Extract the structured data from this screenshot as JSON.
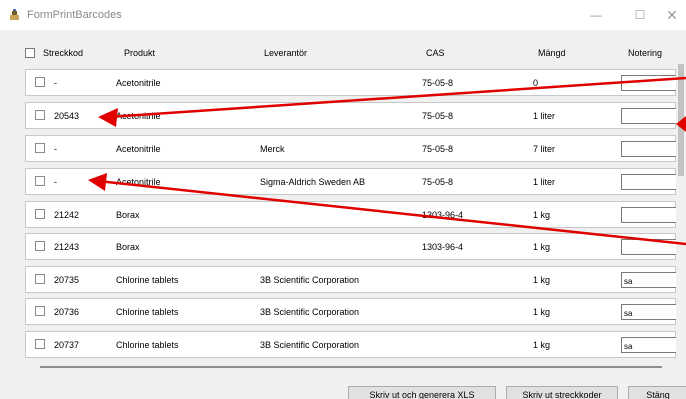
{
  "window": {
    "title": "FormPrintBarcodes",
    "minimize": "—",
    "maximize": "☐",
    "close": "✕"
  },
  "columns": {
    "code": "Streckkod",
    "product": "Produkt",
    "supplier": "Leverantör",
    "cas": "CAS",
    "quantity": "Mängd",
    "note": "Notering"
  },
  "rows": [
    {
      "code": "-",
      "product": "Acetonitrile",
      "supplier": "",
      "cas": "75-05-8",
      "quantity": "0",
      "note": ""
    },
    {
      "code": "20543",
      "product": "Acetonitrile",
      "supplier": "",
      "cas": "75-05-8",
      "quantity": "1 liter",
      "note": ""
    },
    {
      "code": "-",
      "product": "Acetonitrile",
      "supplier": "Merck",
      "cas": "75-05-8",
      "quantity": "7 liter",
      "note": ""
    },
    {
      "code": "-",
      "product": "Acetonitrile",
      "supplier": "Sigma-Aldrich Sweden AB",
      "cas": "75-05-8",
      "quantity": "1 liter",
      "note": ""
    },
    {
      "code": "21242",
      "product": "Borax",
      "supplier": "",
      "cas": "1303-96-4",
      "quantity": "1 kg",
      "note": ""
    },
    {
      "code": "21243",
      "product": "Borax",
      "supplier": "",
      "cas": "1303-96-4",
      "quantity": "1 kg",
      "note": ""
    },
    {
      "code": "20735",
      "product": "Chlorine tablets",
      "supplier": "3B Scientific Corporation",
      "cas": "",
      "quantity": "1 kg",
      "note": "sa"
    },
    {
      "code": "20736",
      "product": "Chlorine tablets",
      "supplier": "3B Scientific Corporation",
      "cas": "",
      "quantity": "1 kg",
      "note": "sa"
    },
    {
      "code": "20737",
      "product": "Chlorine tablets",
      "supplier": "3B Scientific Corporation",
      "cas": "",
      "quantity": "1 kg",
      "note": "sa"
    }
  ],
  "buttons": {
    "generate_xls": "Skriv ut och generera XLS",
    "print_barcodes": "Skriv ut streckkoder",
    "close": "Stäng"
  },
  "colors": {
    "annotation_arrow": "#e00000"
  }
}
